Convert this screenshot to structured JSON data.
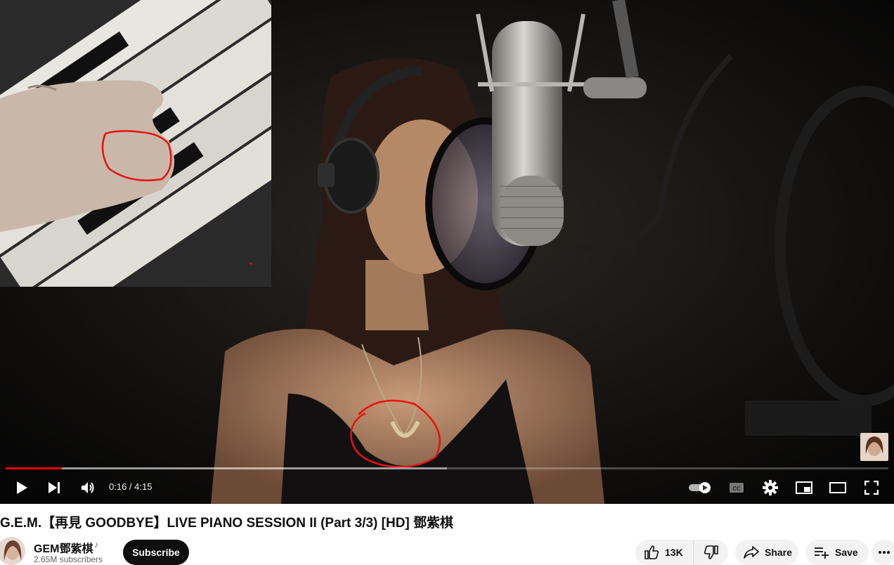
{
  "player": {
    "time_current": "0:16",
    "time_separator": " / ",
    "time_total": "4:15",
    "progress_played_fraction": 0.064,
    "progress_buffered_fraction": 0.5,
    "controls": [
      "play-icon",
      "next-icon",
      "volume-icon",
      "autoplay-toggle-icon",
      "captions-icon",
      "settings-icon",
      "miniplayer-icon",
      "theater-icon",
      "fullscreen-icon"
    ],
    "accent_color": "#ff0000"
  },
  "video": {
    "title": "G.E.M.【再見 GOODBYE】LIVE PIANO SESSION II (Part 3/3) [HD] 鄧紫棋"
  },
  "channel": {
    "name": "GEM鄧紫棋",
    "badge_icon": "music-note-icon",
    "subscribers": "2.65M subscribers",
    "subscribe_label": "Subscribe"
  },
  "actions": {
    "like_count": "13K",
    "share_label": "Share",
    "save_label": "Save"
  }
}
